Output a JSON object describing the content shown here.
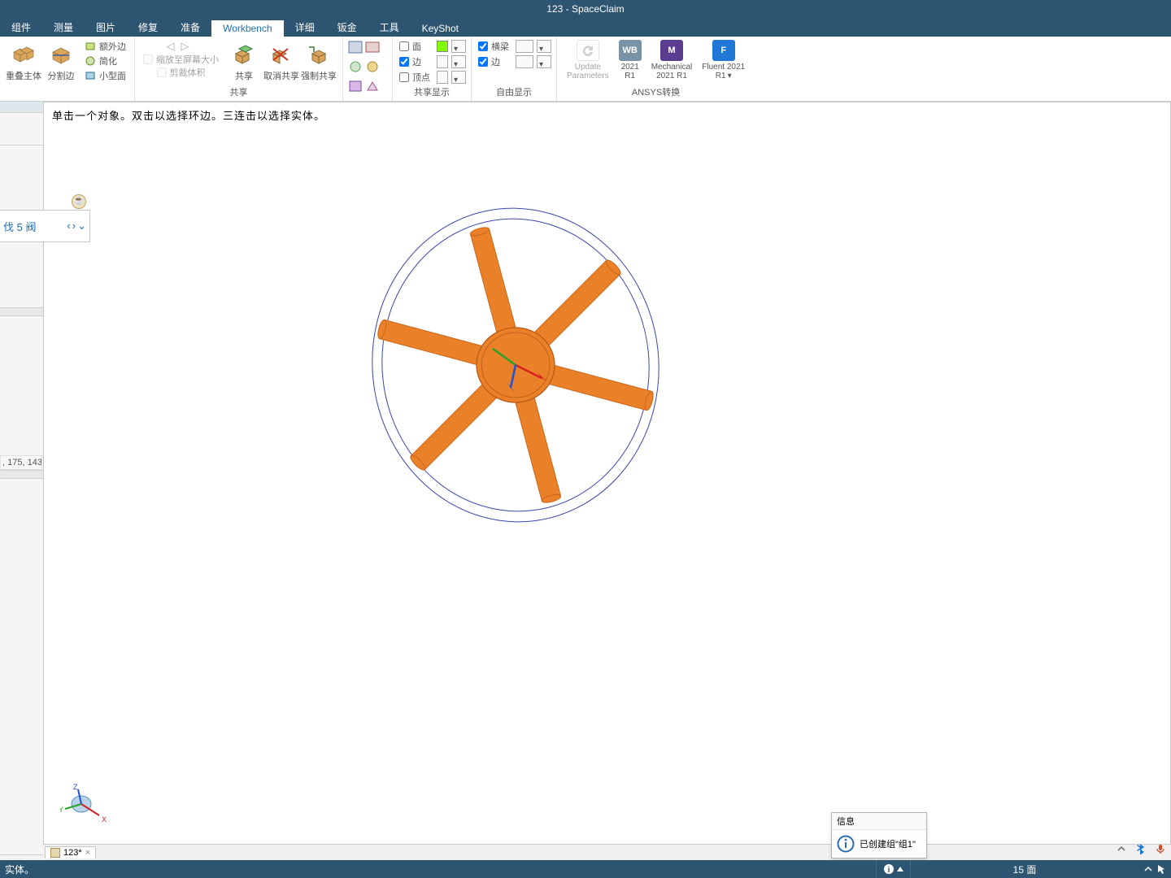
{
  "title": "123 - SpaceClaim",
  "tabs": [
    "组件",
    "测量",
    "图片",
    "修复",
    "准备",
    "Workbench",
    "详细",
    "钣金",
    "工具",
    "KeyShot"
  ],
  "active_tab_index": 5,
  "ribbon": {
    "overlay": {
      "btn1_label": "重叠主体",
      "btn2_label": "分割边"
    },
    "edges": {
      "extra": "额外边",
      "simplify": "简化",
      "small": "小型面"
    },
    "share": {
      "label": "共享",
      "share_btn": "共享",
      "unshare_btn": "取消共享",
      "force_btn": "强制共享",
      "undo_nav": [
        "◁",
        "▷"
      ],
      "chk_zoom": "缩放至屏幕大小",
      "chk_cut": "剪裁体积"
    },
    "misc_grid_icons": 6,
    "share_display": {
      "label": "共享显示",
      "rows": [
        {
          "chk": false,
          "text": "面"
        },
        {
          "chk": true,
          "text": "边"
        },
        {
          "chk": false,
          "text": "顶点"
        }
      ]
    },
    "free_display": {
      "label": "自由显示",
      "rows": [
        {
          "chk": true,
          "text": "横梁"
        },
        {
          "chk": true,
          "text": "边"
        }
      ]
    },
    "ansys": {
      "label": "ANSYS转换",
      "update": {
        "l1": "Update",
        "l2": "Parameters"
      },
      "wb": {
        "badge": "WB",
        "l1": "2021",
        "l2": "R1",
        "color": "#7a92a7"
      },
      "mech": {
        "badge": "M",
        "l1": "Mechanical",
        "l2": "2021 R1",
        "color": "#5a3d8f"
      },
      "fluent": {
        "badge": "F",
        "l1": "Fluent 2021",
        "l2": "R1",
        "color": "#1f77d6"
      }
    }
  },
  "hint": "单击一个对象。双击以选择环边。三连击以选择实体。",
  "nav_panel": {
    "label": "伐  5 阀",
    "arrows": [
      "‹",
      "›",
      "⌄"
    ]
  },
  "rgb_text": ", 175, 143",
  "doc_tab": {
    "name": "123*",
    "close": "×"
  },
  "info_popup": {
    "title": "信息",
    "msg": "已创建组\"组1\""
  },
  "status": {
    "left": "实体。",
    "count": "15 面",
    "info_icon": "i"
  },
  "triad_labels": {
    "x": "X",
    "y": "Y",
    "z": "Z"
  },
  "colors": {
    "accent": "#2d5470",
    "orange": "#ea8027",
    "wire": "#3a46ad"
  }
}
